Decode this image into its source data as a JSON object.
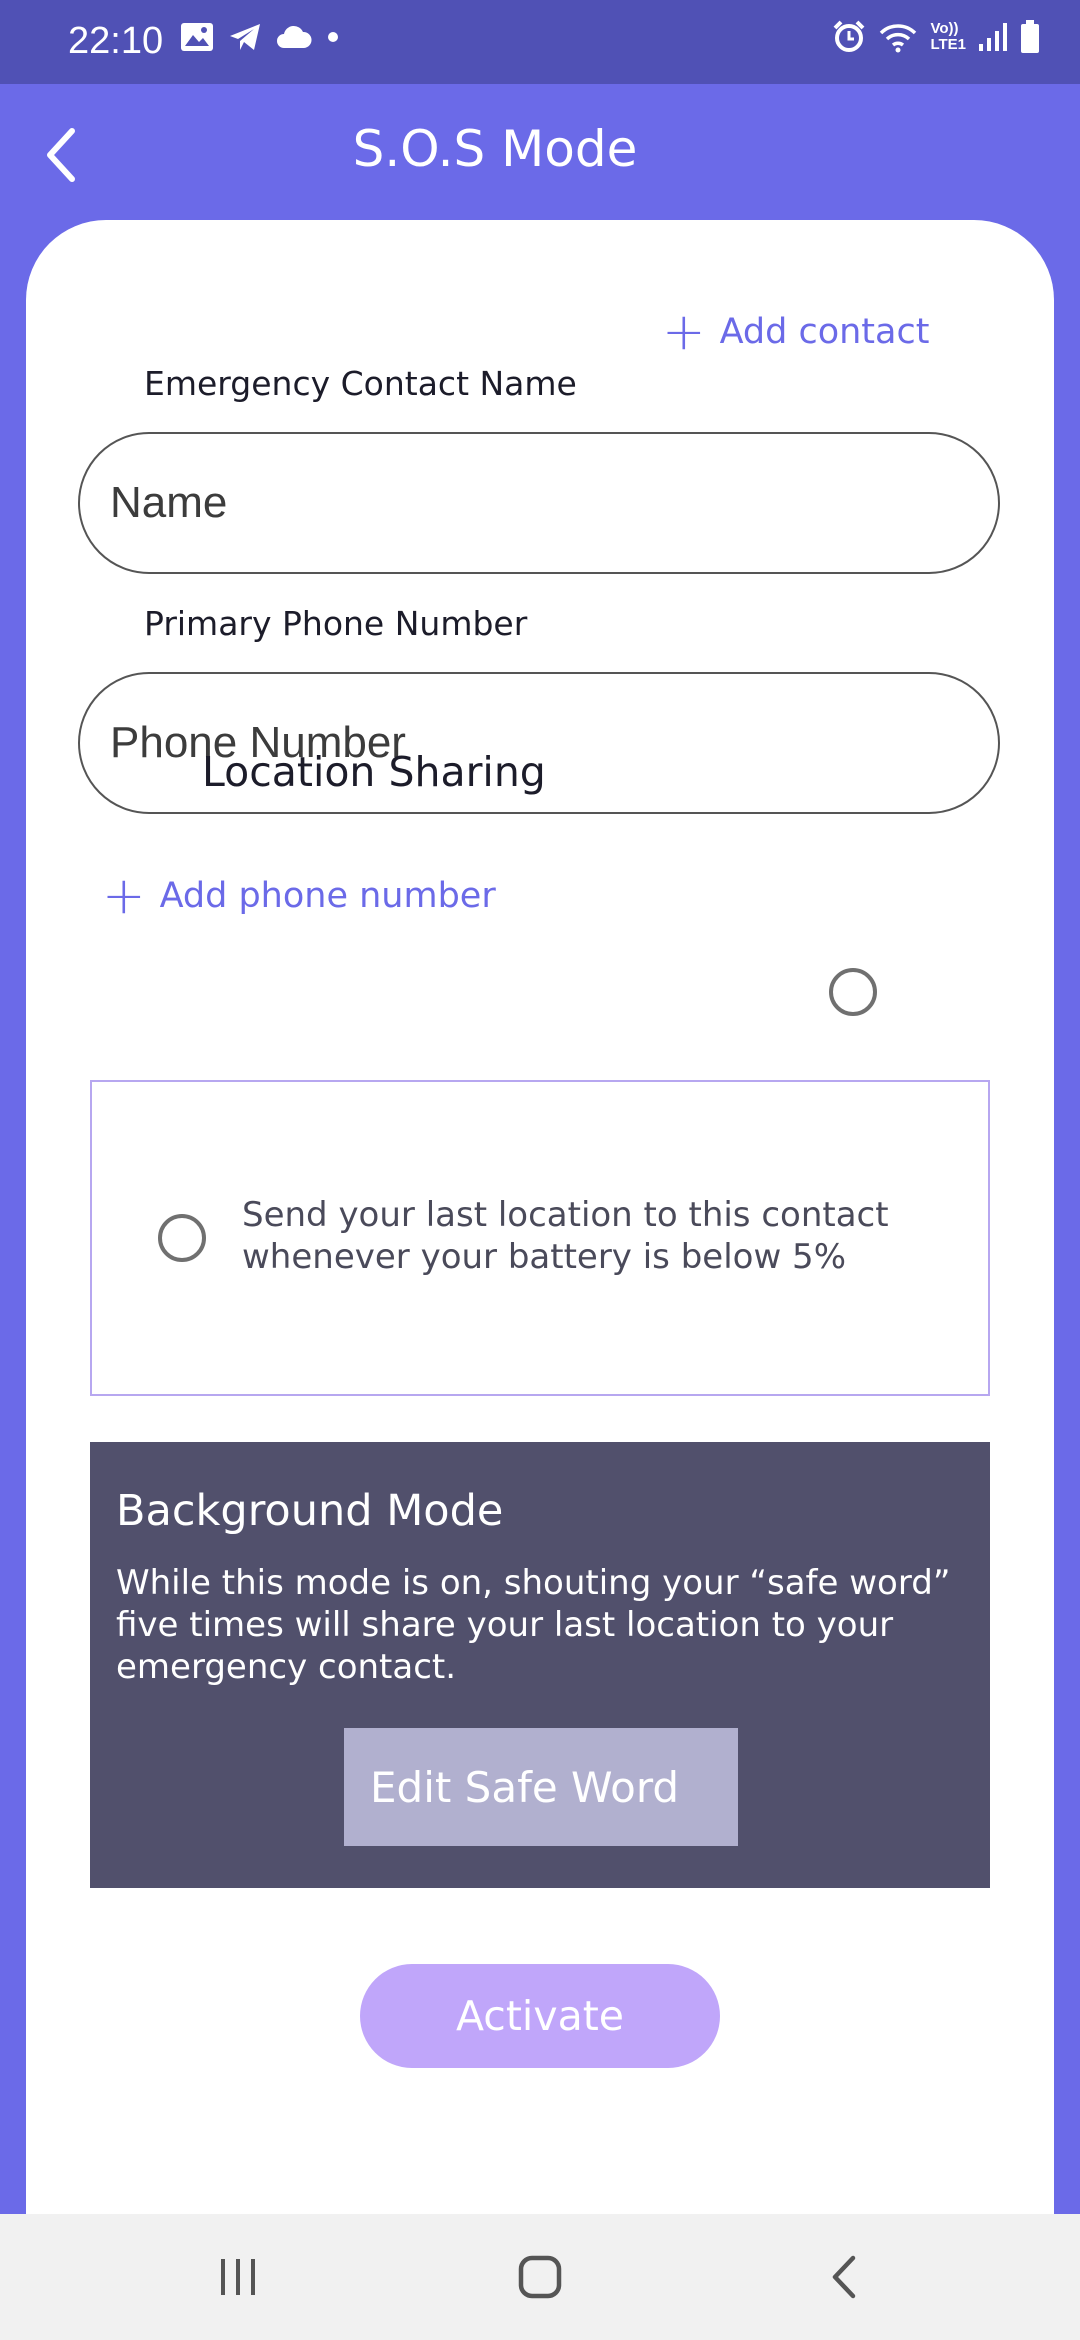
{
  "status_bar": {
    "time": "22:10",
    "left_icons": [
      "image-icon",
      "telegram-icon",
      "cloud-icon",
      "dot-icon"
    ],
    "right_icons": [
      "alarm-icon",
      "wifi-icon",
      "volte-icon",
      "signal-icon",
      "battery-icon"
    ],
    "network_label_top": "Vo))",
    "network_label_bottom": "LTE1"
  },
  "header": {
    "title": "S.O.S Mode",
    "back_icon": "chevron-left-icon"
  },
  "contact": {
    "add_contact_label": "Add contact",
    "name_label": "Emergency Contact Name",
    "name_placeholder": "Name",
    "phone_label": "Primary Phone Number",
    "phone_placeholder": "Phone Number",
    "add_phone_label": "Add phone number"
  },
  "location": {
    "label": "Location Sharing",
    "battery_text": "Send your last location to this contact\n whenever your battery is below 5%"
  },
  "background_mode": {
    "title": "Background Mode",
    "description": "While this mode is on, shouting your “safe word” five times will share your last location to your emergency contact.",
    "edit_button": "Edit Safe Word"
  },
  "activate_label": "Activate",
  "colors": {
    "accent": "#6b6ae8",
    "status_bar": "#5051b5",
    "panel": "#51506c",
    "activate": "#c0a6fa"
  },
  "nav_bar": {
    "icons": [
      "recent-apps-icon",
      "home-icon",
      "back-icon"
    ]
  }
}
